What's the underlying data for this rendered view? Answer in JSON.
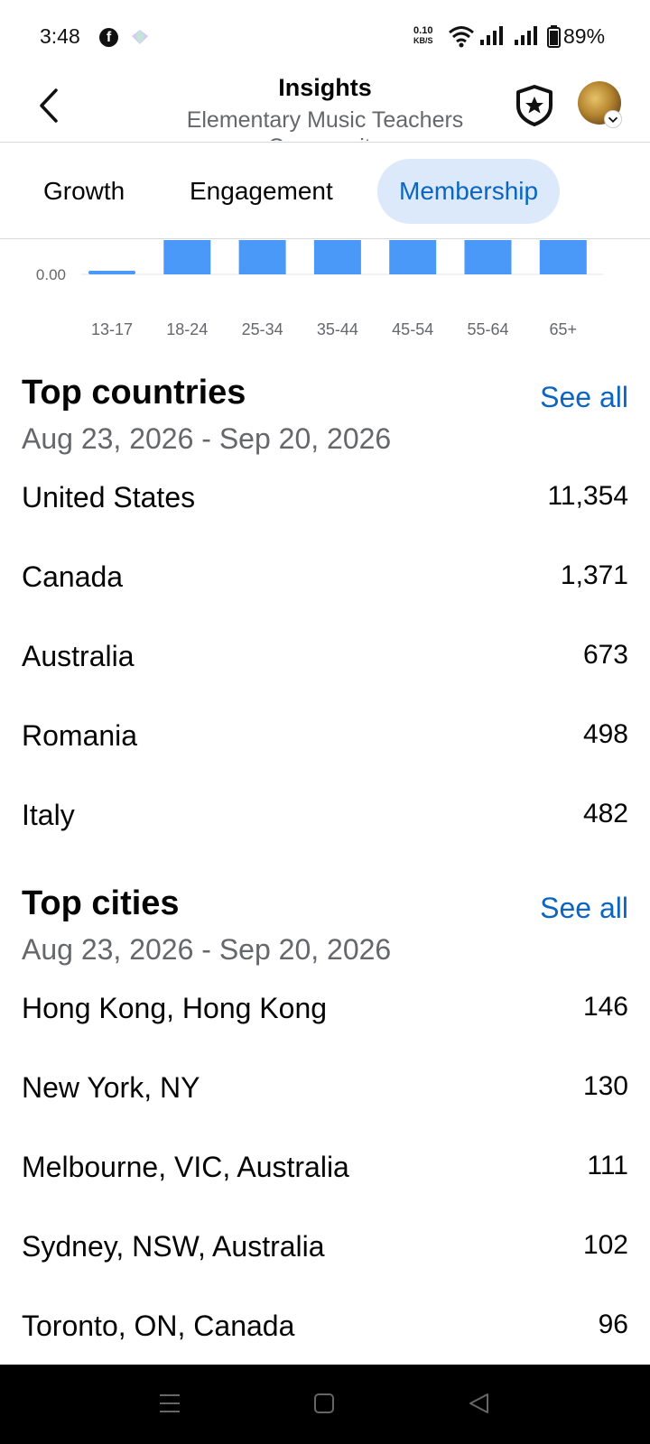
{
  "status_bar": {
    "time": "3:48",
    "net_speed_value": "0.10",
    "net_speed_unit": "KB/S",
    "battery": "89%"
  },
  "header": {
    "title": "Insights",
    "subtitle": "Elementary Music Teachers Community"
  },
  "tabs": [
    {
      "label": "Growth",
      "active": false
    },
    {
      "label": "Engagement",
      "active": false
    },
    {
      "label": "Membership",
      "active": true
    }
  ],
  "chart_data": {
    "type": "bar",
    "categories": [
      "13-17",
      "18-24",
      "25-34",
      "35-44",
      "45-54",
      "55-64",
      "65+"
    ],
    "values": [
      0.002,
      null,
      null,
      null,
      null,
      null,
      null
    ],
    "visible_tick": "0.00",
    "color": "#4a98f7",
    "note_visible_portion": "chart is scrolled; only the bottom of bars, the 0.00 tick and category labels are visible"
  },
  "top_countries": {
    "title": "Top countries",
    "see_all": "See all",
    "date_range": "Aug 23, 2026 - Sep 20, 2026",
    "items": [
      {
        "name": "United States",
        "value": "11,354"
      },
      {
        "name": "Canada",
        "value": "1,371"
      },
      {
        "name": "Australia",
        "value": "673"
      },
      {
        "name": "Romania",
        "value": "498"
      },
      {
        "name": "Italy",
        "value": "482"
      }
    ]
  },
  "top_cities": {
    "title": "Top cities",
    "see_all": "See all",
    "date_range": "Aug 23, 2026 - Sep 20, 2026",
    "items": [
      {
        "name": "Hong Kong, Hong Kong",
        "value": "146"
      },
      {
        "name": "New York, NY",
        "value": "130"
      },
      {
        "name": "Melbourne, VIC, Australia",
        "value": "111"
      },
      {
        "name": "Sydney, NSW, Australia",
        "value": "102"
      },
      {
        "name": "Toronto, ON, Canada",
        "value": "96"
      }
    ]
  },
  "colors": {
    "accent": "#0a66c2",
    "tab_active_bg": "#dbe9fb",
    "bar": "#4a98f7",
    "secondary_text": "#65676b"
  }
}
